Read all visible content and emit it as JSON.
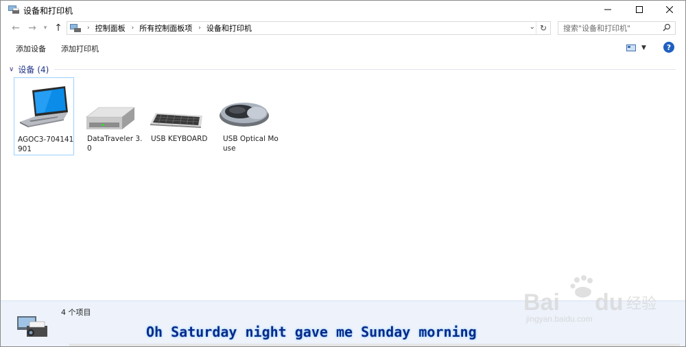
{
  "window": {
    "title": "设备和打印机"
  },
  "address": {
    "crumbs": [
      "控制面板",
      "所有控制面板项",
      "设备和打印机"
    ]
  },
  "search": {
    "placeholder": "搜索\"设备和打印机\""
  },
  "commands": {
    "add_device": "添加设备",
    "add_printer": "添加打印机"
  },
  "group": {
    "title": "设备",
    "count": "(4)"
  },
  "devices": [
    {
      "label": "AGOC3-704141901",
      "icon": "laptop-icon"
    },
    {
      "label": "DataTraveler 3.0",
      "icon": "drive-icon"
    },
    {
      "label": "USB KEYBOARD",
      "icon": "keyboard-icon"
    },
    {
      "label": "USB Optical Mouse",
      "icon": "mouse-icon"
    }
  ],
  "status": {
    "count": "4 个项目"
  },
  "subtitle": "Oh Saturday night gave me Sunday morning",
  "watermark": {
    "text": "jingyan.baidu.com"
  },
  "colors": {
    "accent": "#1f5fc0",
    "group_title": "#1e3287",
    "status_bg": "#edf2fb",
    "selection_border": "#99d1ff"
  }
}
